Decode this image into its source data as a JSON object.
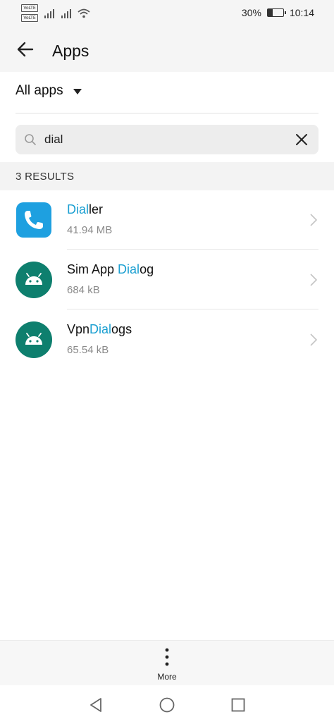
{
  "status_bar": {
    "sim1_label": "VoLTE",
    "sim2_label": "VoLTE",
    "battery_text": "30%",
    "battery_level": 0.3,
    "time": "10:14"
  },
  "header": {
    "title": "Apps"
  },
  "filter": {
    "label": "All apps"
  },
  "search": {
    "value": "dial"
  },
  "results": {
    "label": "3 RESULTS",
    "items": [
      {
        "pre": "",
        "match": "Dial",
        "post": "ler",
        "size": "41.94 MB",
        "icon": "phone-app-icon"
      },
      {
        "pre": "Sim App ",
        "match": "Dial",
        "post": "og",
        "size": "684 kB",
        "icon": "android-icon"
      },
      {
        "pre": "Vpn",
        "match": "Dial",
        "post": "ogs",
        "size": "65.54 kB",
        "icon": "android-icon"
      }
    ]
  },
  "bottom": {
    "more_label": "More"
  },
  "colors": {
    "highlight": "#1a9fd1",
    "android_bg": "#0e7f6e",
    "dialer_bg": "#1ea0e0"
  }
}
